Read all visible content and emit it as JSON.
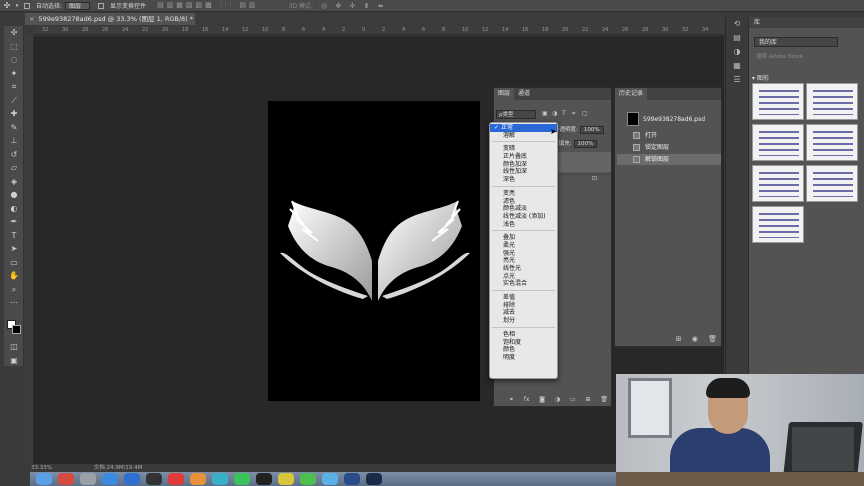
{
  "options_bar": {
    "auto_select_label": "自动选择:",
    "auto_select_value": "图层",
    "show_transform_label": "显示变换控件",
    "mode_3d_label": "3D 模式:"
  },
  "document_tab": {
    "title": "599e938278ad6.psd @ 33.3% (图层 1, RGB/8) *"
  },
  "ruler_ticks": [
    "32",
    "30",
    "28",
    "26",
    "24",
    "22",
    "20",
    "18",
    "16",
    "14",
    "12",
    "10",
    "8",
    "6",
    "4",
    "2",
    "0",
    "2",
    "4",
    "6",
    "8",
    "10",
    "12",
    "14",
    "16",
    "18",
    "20",
    "22",
    "24",
    "26",
    "28",
    "30",
    "32",
    "34"
  ],
  "status_bar": {
    "zoom": "33.33%",
    "doc_size": "文档:24.9M/19.4M"
  },
  "layers_panel": {
    "tab_layers": "图层",
    "tab_channels": "通道",
    "filter_kind": "ρ类型",
    "opacity_label": "不透明度:",
    "opacity_value": "100%",
    "fill_label": "填充:",
    "fill_value": "100%"
  },
  "blend_modes": {
    "selected": "正常",
    "groups": [
      [
        "正常",
        "溶解"
      ],
      [
        "变暗",
        "正片叠底",
        "颜色加深",
        "线性加深",
        "深色"
      ],
      [
        "变亮",
        "滤色",
        "颜色减淡",
        "线性减淡 (添加)",
        "浅色"
      ],
      [
        "叠加",
        "柔光",
        "强光",
        "亮光",
        "线性光",
        "点光",
        "实色混合"
      ],
      [
        "差值",
        "排除",
        "减去",
        "划分"
      ],
      [
        "色相",
        "饱和度",
        "颜色",
        "明度"
      ]
    ]
  },
  "history_panel": {
    "title": "历史记录",
    "snapshot": "599e938278ad6.psd",
    "items": [
      "打开",
      "锁定图层",
      "解锁图层"
    ]
  },
  "library_panel": {
    "title": "库",
    "library_name": "我的库",
    "search_placeholder": "搜索 Adobe Stock",
    "group_label": "▾ 图形"
  }
}
